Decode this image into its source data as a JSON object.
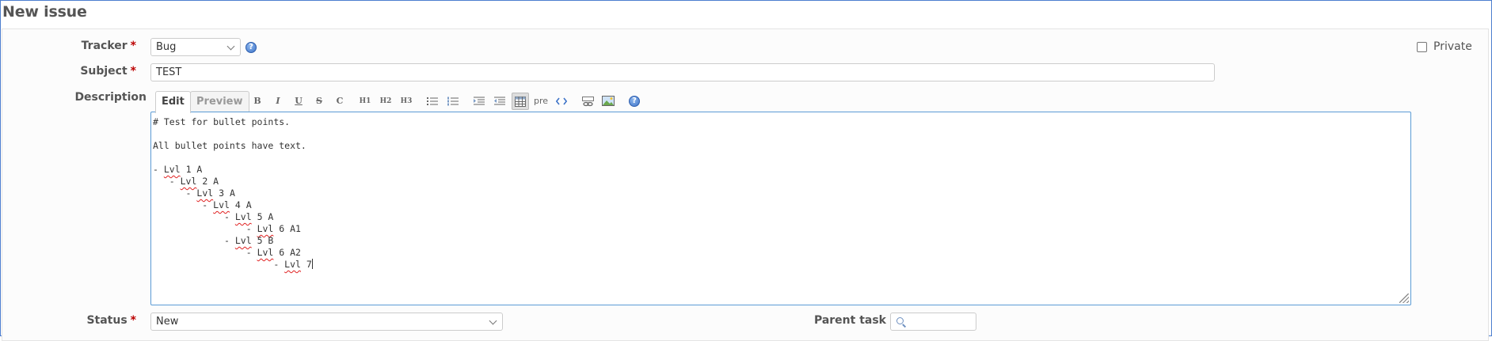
{
  "page": {
    "title": "New issue"
  },
  "form": {
    "tracker": {
      "label": "Tracker",
      "required": "*",
      "value": "Bug",
      "help": "?"
    },
    "private": {
      "label": "Private"
    },
    "subject": {
      "label": "Subject",
      "required": "*",
      "value": "TEST"
    },
    "description": {
      "label": "Description",
      "tabs": {
        "edit": "Edit",
        "preview": "Preview"
      },
      "toolbar": {
        "bold": "B",
        "italic": "I",
        "underline": "U",
        "strike": "S",
        "code": "C",
        "h1": "H1",
        "h2": "H2",
        "h3": "H3",
        "pre": "pre",
        "help": "?"
      },
      "lines": [
        {
          "indent": "",
          "text": "# Test for bullet points."
        },
        {
          "indent": "",
          "text": ""
        },
        {
          "indent": "",
          "text": "All bullet points have text."
        },
        {
          "indent": "",
          "text": ""
        },
        {
          "indent": "- ",
          "word": "Lvl",
          "rest": " 1 A"
        },
        {
          "indent": "   - ",
          "word": "Lvl",
          "rest": " 2 A"
        },
        {
          "indent": "      - ",
          "word": "Lvl",
          "rest": " 3 A"
        },
        {
          "indent": "         - ",
          "word": "Lvl",
          "rest": " 4 A"
        },
        {
          "indent": "             - ",
          "word": "Lvl",
          "rest": " 5 A"
        },
        {
          "indent": "                 - ",
          "word": "Lvl",
          "rest": " 6 A1"
        },
        {
          "indent": "             - ",
          "word": "Lvl",
          "rest": " 5 B"
        },
        {
          "indent": "                 - ",
          "word": "Lvl",
          "rest": " 6 A2"
        },
        {
          "indent": "                      - ",
          "word": "Lvl",
          "rest": " 7"
        }
      ]
    },
    "status": {
      "label": "Status",
      "required": "*",
      "value": "New"
    },
    "parent_task": {
      "label": "Parent task",
      "value": ""
    }
  }
}
